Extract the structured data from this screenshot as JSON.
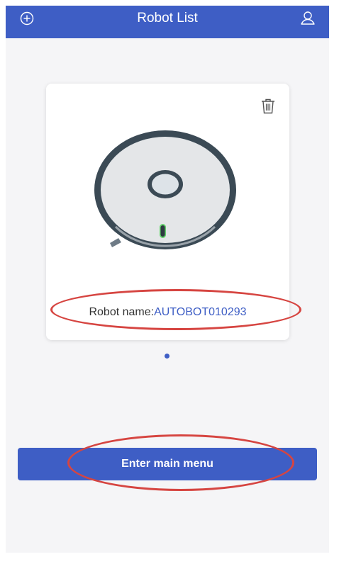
{
  "header": {
    "title": "Robot List",
    "left_icon": "add-circle-icon",
    "right_icon": "user-profile-icon"
  },
  "robot_card": {
    "delete_icon": "trash-icon",
    "image_icon": "robot-vacuum-icon",
    "name_label": "Robot name:",
    "name_value": "AUTOBOT010293"
  },
  "pager": {
    "current_page": 1,
    "total_pages": 1
  },
  "actions": {
    "enter_main_menu_label": "Enter main menu"
  },
  "colors": {
    "accent": "#3e5ec5",
    "annotation_red": "#d64541",
    "background": "#f5f5f7"
  }
}
